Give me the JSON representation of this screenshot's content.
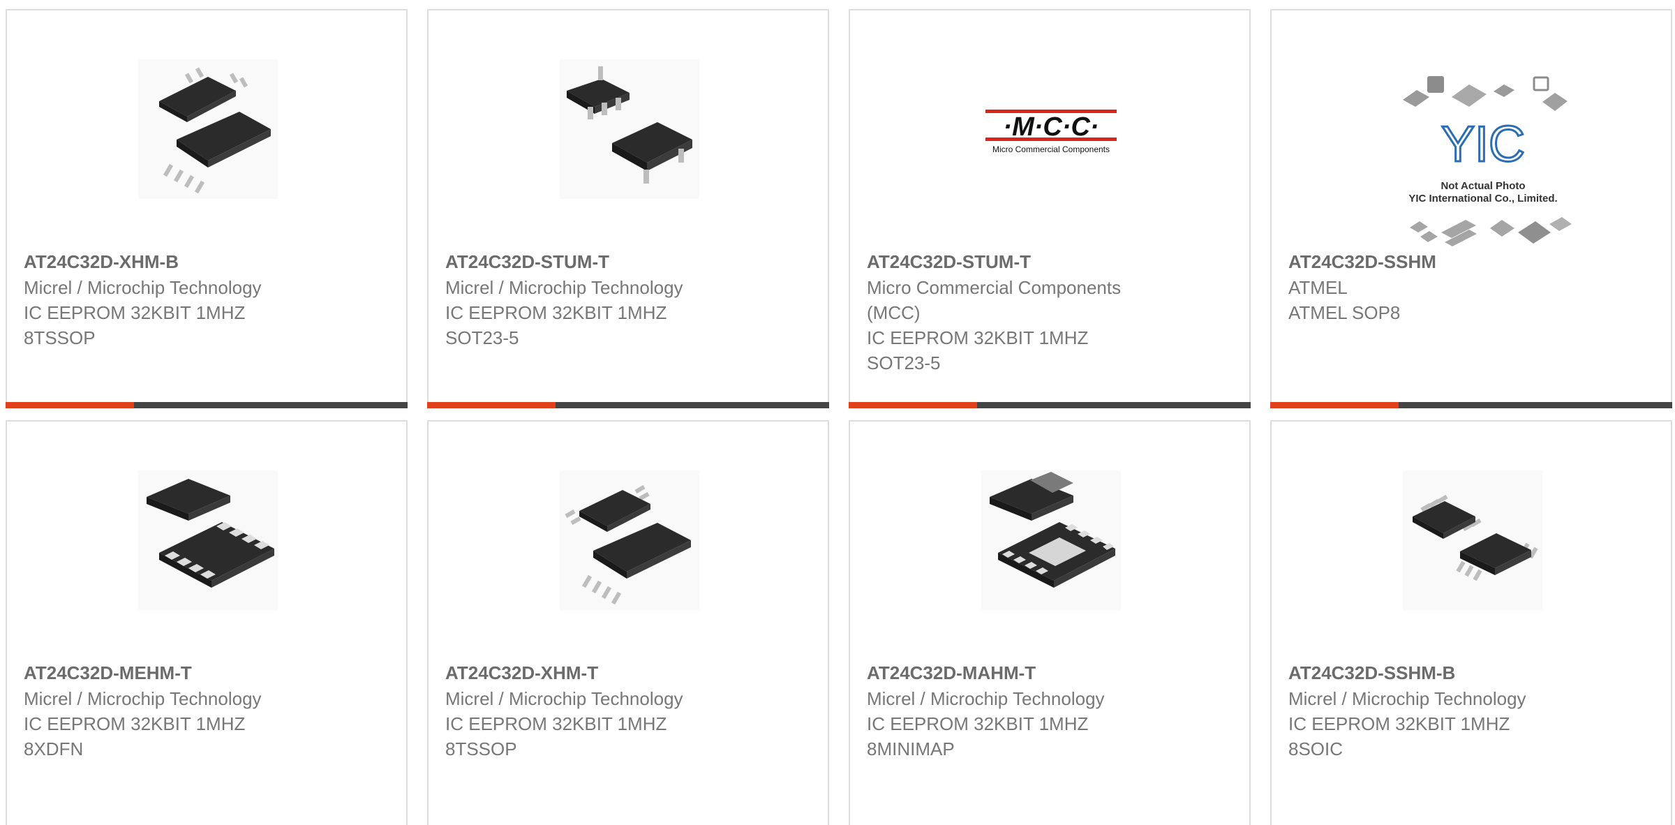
{
  "products": [
    {
      "part": "AT24C32D-XHM-B",
      "lines": [
        "Micrel / Microchip Technology",
        "IC EEPROM 32KBIT 1MHZ",
        "8TSSOP"
      ],
      "image_icon": "tssop-chip-icon"
    },
    {
      "part": "AT24C32D-STUM-T",
      "lines": [
        "Micrel / Microchip Technology",
        "IC EEPROM 32KBIT 1MHZ",
        "SOT23-5"
      ],
      "image_icon": "sot23-chip-icon"
    },
    {
      "part": "AT24C32D-STUM-T",
      "lines": [
        "Micro Commercial Components",
        "(MCC)",
        "IC EEPROM 32KBIT 1MHZ",
        "SOT23-5"
      ],
      "image_icon": "mcc-logo",
      "logo_text": "·M·C·C·",
      "logo_subtext": "Micro Commercial Components"
    },
    {
      "part": "AT24C32D-SSHM",
      "lines": [
        "ATMEL",
        "ATMEL SOP8"
      ],
      "image_icon": "yic-placeholder",
      "logo_text": "YIC",
      "placeholder_line1": "Not Actual Photo",
      "placeholder_line2": "YIC International Co., Limited."
    },
    {
      "part": "AT24C32D-MEHM-T",
      "lines": [
        "Micrel / Microchip Technology",
        "IC EEPROM 32KBIT 1MHZ",
        "8XDFN"
      ],
      "image_icon": "xdfn-chip-icon"
    },
    {
      "part": "AT24C32D-XHM-T",
      "lines": [
        "Micrel / Microchip Technology",
        "IC EEPROM 32KBIT 1MHZ",
        "8TSSOP"
      ],
      "image_icon": "tssop-chip-icon"
    },
    {
      "part": "AT24C32D-MAHM-T",
      "lines": [
        "Micrel / Microchip Technology",
        "IC EEPROM 32KBIT 1MHZ",
        "8MINIMAP"
      ],
      "image_icon": "minimap-chip-icon"
    },
    {
      "part": "AT24C32D-SSHM-B",
      "lines": [
        "Micrel / Microchip Technology",
        "IC EEPROM 32KBIT 1MHZ",
        "8SOIC"
      ],
      "image_icon": "soic-chip-icon"
    }
  ],
  "colors": {
    "accent_bar": "#e0401a",
    "bar_dark": "#444444",
    "border": "#dddddd",
    "mcc_red": "#d9261c"
  }
}
